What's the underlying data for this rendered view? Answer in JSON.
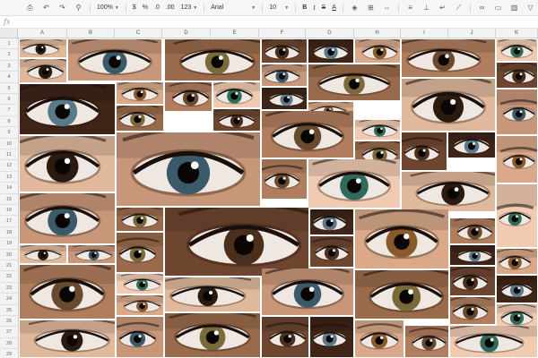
{
  "toolbar": {
    "zoom": "100%",
    "currency": "$",
    "percent": "%",
    "dec_decrease": ".0",
    "dec_increase": ".00",
    "format_more": "123",
    "font": "Arial",
    "font_size": "10",
    "bold": "B",
    "italic": "I",
    "strike": "S",
    "text_color": "A",
    "icons": [
      "print-icon",
      "undo-icon",
      "redo-icon",
      "paint-format-icon",
      "fill-color-icon",
      "borders-icon",
      "merge-icon",
      "align-left-icon",
      "valign-icon",
      "wrap-icon",
      "rotate-icon",
      "link-icon",
      "comment-icon",
      "chart-icon",
      "filter-icon"
    ]
  },
  "formula_bar": {
    "fx": "fx",
    "value": ""
  },
  "columns": [
    "A",
    "B",
    "C",
    "D",
    "E",
    "F",
    "G",
    "H",
    "I",
    "J",
    "K"
  ],
  "rows": [
    "1",
    "2",
    "3",
    "4",
    "5",
    "6",
    "7",
    "8",
    "9",
    "10",
    "11",
    "12",
    "13",
    "14",
    "15",
    "16",
    "17",
    "18",
    "19",
    "20",
    "21",
    "22",
    "23",
    "24",
    "25",
    "26",
    "27",
    "28",
    "29",
    "30"
  ],
  "collage": {
    "description_tiles": 60,
    "palette": {
      "skin": [
        "#e0b89c",
        "#c8977a",
        "#9a6a4c",
        "#6e4630",
        "#3e2518",
        "#d9a98a",
        "#b07e5e",
        "#f0cbb2"
      ],
      "iris": [
        "#2b1a10",
        "#4a2f1c",
        "#6a4a2e",
        "#3a5a6a",
        "#5a7a8a",
        "#2f6a5a",
        "#7a6a3a",
        "#8a5a2a"
      ]
    }
  }
}
